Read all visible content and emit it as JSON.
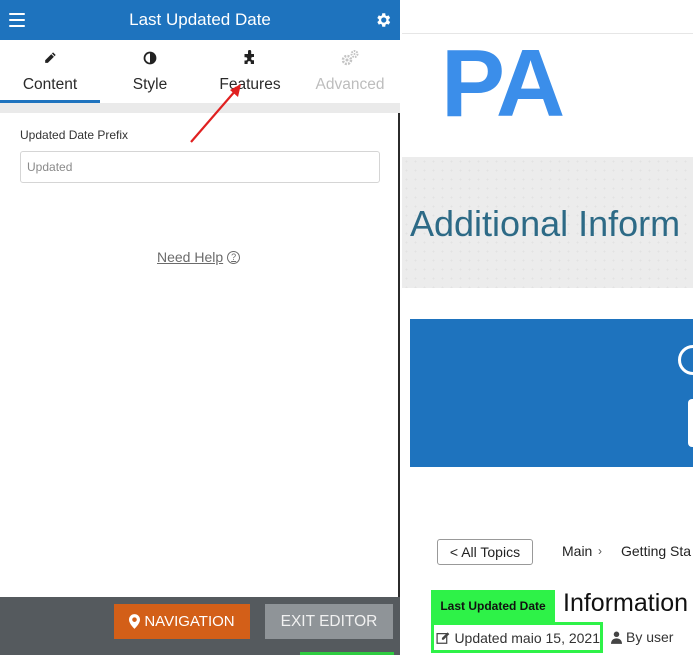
{
  "editor": {
    "title": "Last Updated Date",
    "tabs": [
      {
        "label": "Content",
        "icon": "pencil-icon"
      },
      {
        "label": "Style",
        "icon": "half-circle-icon"
      },
      {
        "label": "Features",
        "icon": "puzzle-icon"
      },
      {
        "label": "Advanced",
        "icon": "gears-icon"
      }
    ],
    "active_tab": "Content",
    "field": {
      "label": "Updated Date Prefix",
      "placeholder": "Updated"
    },
    "help_label": "Need Help",
    "footer": {
      "navigation_label": "NAVIGATION",
      "exit_label": "EXIT EDITOR"
    },
    "colors": {
      "header": "#1e73be",
      "nav_button": "#d35f18",
      "exit_button": "#8f9498",
      "footer": "#555a5e",
      "arrow": "#e02020"
    }
  },
  "preview": {
    "logo_text": "PA",
    "banner_title": "Additional Inform",
    "all_topics_label": "< All Topics",
    "breadcrumb": [
      "Main",
      "Getting Sta"
    ],
    "widget_label": "Last Updated Date",
    "article_title": "Information",
    "updated_text": "Updated maio 15, 2021",
    "author_text": "By user",
    "colors": {
      "logo": "#3b8eea",
      "blue_box": "#1e73be",
      "highlight": "#2ef248",
      "banner_title": "#2d6a86"
    }
  }
}
